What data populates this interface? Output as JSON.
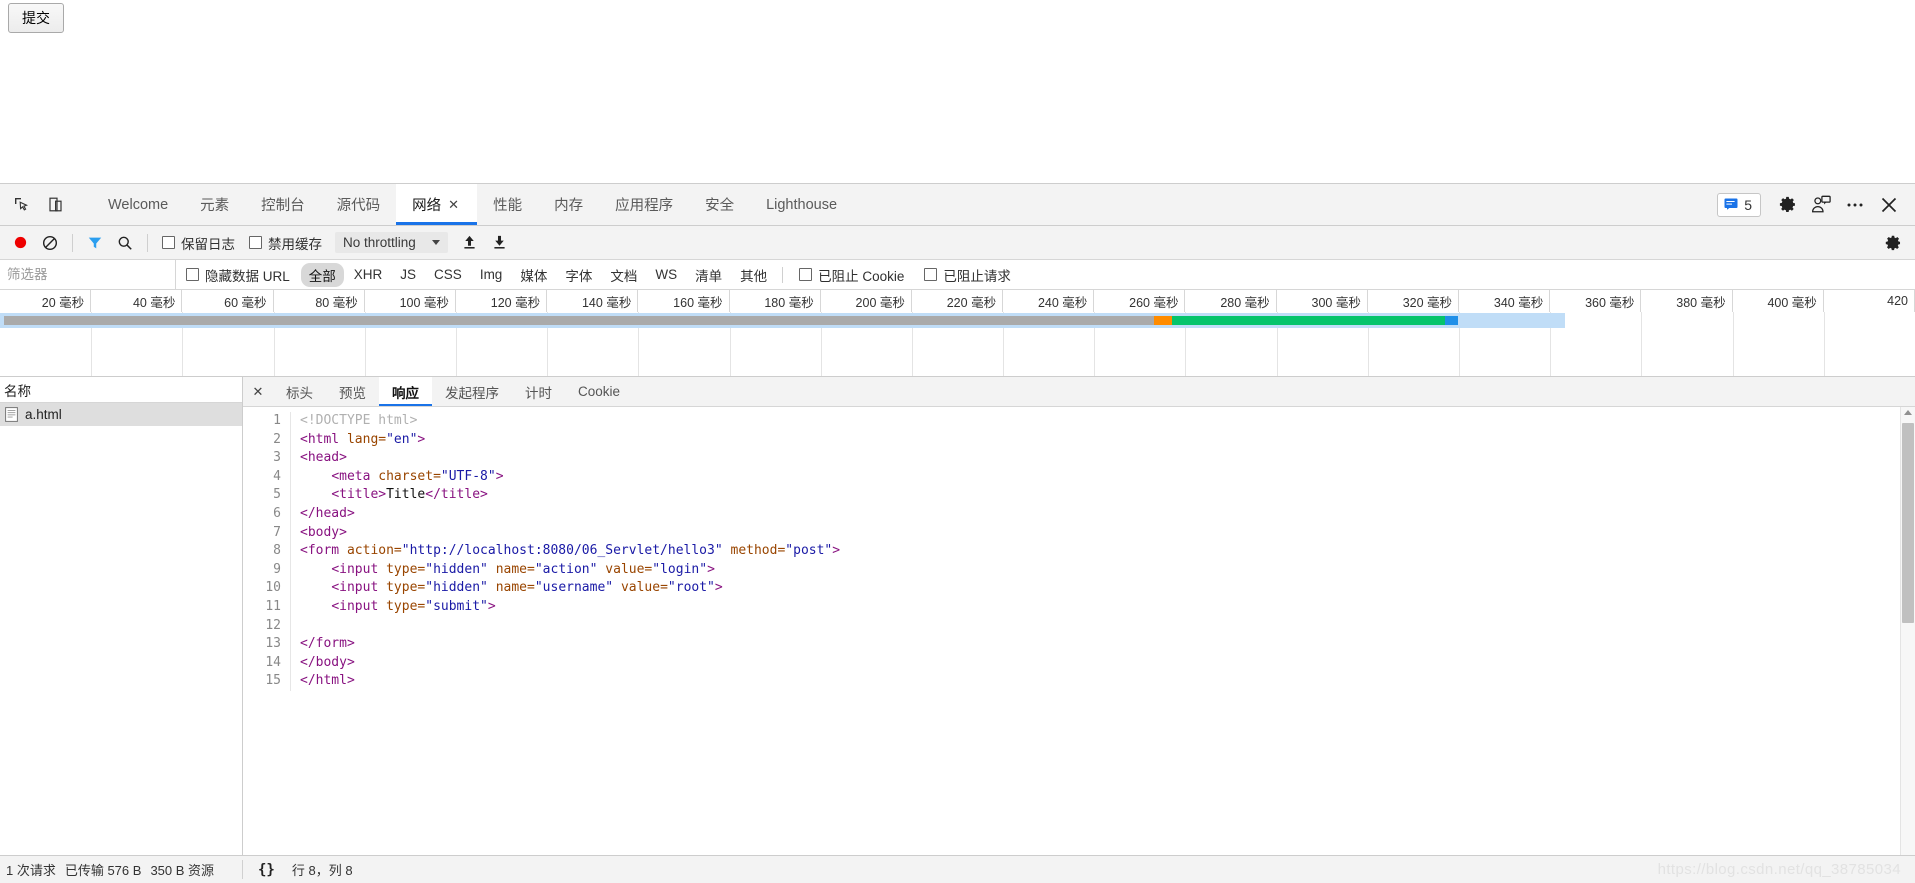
{
  "page": {
    "submit_button_label": "提交"
  },
  "tabbar": {
    "icons": [
      {
        "name": "inspect-element-icon"
      },
      {
        "name": "device-toolbar-icon"
      }
    ],
    "tabs": [
      {
        "label": "Welcome",
        "active": false
      },
      {
        "label": "元素",
        "active": false
      },
      {
        "label": "控制台",
        "active": false
      },
      {
        "label": "源代码",
        "active": false
      },
      {
        "label": "网络",
        "active": true,
        "close": "✕"
      },
      {
        "label": "性能",
        "active": false
      },
      {
        "label": "内存",
        "active": false
      },
      {
        "label": "应用程序",
        "active": false
      },
      {
        "label": "安全",
        "active": false
      },
      {
        "label": "Lighthouse",
        "active": false
      }
    ],
    "message_count": "5",
    "right_icons": [
      {
        "name": "settings-gear-icon"
      },
      {
        "name": "feedback-icon"
      },
      {
        "name": "more-options-icon"
      },
      {
        "name": "close-devtools-icon"
      }
    ]
  },
  "network_toolbar": {
    "record_title": "record-button",
    "clear_title": "clear-button",
    "filter_title": "filter-toggle",
    "search_title": "search-button",
    "preserve_log_label": "保留日志",
    "disable_cache_label": "禁用缓存",
    "throttling_value": "No throttling",
    "import_title": "import-har",
    "export_title": "export-har",
    "settings_title": "network-settings"
  },
  "filter_bar": {
    "filter_placeholder": "筛选器",
    "filter_value": "",
    "hide_data_urls_label": "隐藏数据 URL",
    "types": [
      {
        "label": "全部",
        "selected": true
      },
      {
        "label": "XHR",
        "selected": false
      },
      {
        "label": "JS",
        "selected": false
      },
      {
        "label": "CSS",
        "selected": false
      },
      {
        "label": "Img",
        "selected": false
      },
      {
        "label": "媒体",
        "selected": false
      },
      {
        "label": "字体",
        "selected": false
      },
      {
        "label": "文档",
        "selected": false
      },
      {
        "label": "WS",
        "selected": false
      },
      {
        "label": "清单",
        "selected": false
      },
      {
        "label": "其他",
        "selected": false
      }
    ],
    "blocked_cookies_label": "已阻止 Cookie",
    "blocked_requests_label": "已阻止请求"
  },
  "overview": {
    "ticks": [
      "20 毫秒",
      "40 毫秒",
      "60 毫秒",
      "80 毫秒",
      "100 毫秒",
      "120 毫秒",
      "140 毫秒",
      "160 毫秒",
      "180 毫秒",
      "200 毫秒",
      "220 毫秒",
      "240 毫秒",
      "260 毫秒",
      "280 毫秒",
      "300 毫秒",
      "320 毫秒",
      "340 毫秒",
      "360 毫秒",
      "380 毫秒",
      "400 毫秒",
      "420"
    ],
    "waterfall_colors": {
      "queueing": "#aaaaaa",
      "stalled": "#ff8c00",
      "waiting": "#05c46b",
      "download": "#1f8fe8",
      "band": "#c0ddf7"
    }
  },
  "request_list": {
    "column_header": "名称",
    "rows": [
      {
        "name": "a.html",
        "selected": true
      }
    ]
  },
  "detail_panel": {
    "close_label": "✕",
    "tabs": [
      {
        "label": "标头",
        "active": false
      },
      {
        "label": "预览",
        "active": false
      },
      {
        "label": "响应",
        "active": true
      },
      {
        "label": "发起程序",
        "active": false
      },
      {
        "label": "计时",
        "active": false
      },
      {
        "label": "Cookie",
        "active": false
      }
    ],
    "code_lines": [
      {
        "n": "1",
        "tokens": [
          {
            "t": "doc",
            "v": "<!DOCTYPE html>"
          }
        ]
      },
      {
        "n": "2",
        "tokens": [
          {
            "t": "tag",
            "v": "<html "
          },
          {
            "t": "attr",
            "v": "lang="
          },
          {
            "t": "val",
            "v": "\"en\""
          },
          {
            "t": "tag",
            "v": ">"
          }
        ]
      },
      {
        "n": "3",
        "tokens": [
          {
            "t": "tag",
            "v": "<head>"
          }
        ]
      },
      {
        "n": "4",
        "tokens": [
          {
            "t": "txt",
            "v": "    "
          },
          {
            "t": "tag",
            "v": "<meta "
          },
          {
            "t": "attr",
            "v": "charset="
          },
          {
            "t": "val",
            "v": "\"UTF-8\""
          },
          {
            "t": "tag",
            "v": ">"
          }
        ]
      },
      {
        "n": "5",
        "tokens": [
          {
            "t": "txt",
            "v": "    "
          },
          {
            "t": "tag",
            "v": "<title>"
          },
          {
            "t": "txt",
            "v": "Title"
          },
          {
            "t": "tag",
            "v": "</title>"
          }
        ]
      },
      {
        "n": "6",
        "tokens": [
          {
            "t": "tag",
            "v": "</head>"
          }
        ]
      },
      {
        "n": "7",
        "tokens": [
          {
            "t": "tag",
            "v": "<body>"
          }
        ]
      },
      {
        "n": "8",
        "tokens": [
          {
            "t": "tag",
            "v": "<form "
          },
          {
            "t": "attr",
            "v": "action="
          },
          {
            "t": "val",
            "v": "\"http://localhost:8080/06_Servlet/hello3\""
          },
          {
            "t": "attr",
            "v": " method="
          },
          {
            "t": "val",
            "v": "\"post\""
          },
          {
            "t": "tag",
            "v": ">"
          }
        ]
      },
      {
        "n": "9",
        "tokens": [
          {
            "t": "txt",
            "v": "    "
          },
          {
            "t": "tag",
            "v": "<input "
          },
          {
            "t": "attr",
            "v": "type="
          },
          {
            "t": "val",
            "v": "\"hidden\""
          },
          {
            "t": "attr",
            "v": " name="
          },
          {
            "t": "val",
            "v": "\"action\""
          },
          {
            "t": "attr",
            "v": " value="
          },
          {
            "t": "val",
            "v": "\"login\""
          },
          {
            "t": "tag",
            "v": ">"
          }
        ]
      },
      {
        "n": "10",
        "tokens": [
          {
            "t": "txt",
            "v": "    "
          },
          {
            "t": "tag",
            "v": "<input "
          },
          {
            "t": "attr",
            "v": "type="
          },
          {
            "t": "val",
            "v": "\"hidden\""
          },
          {
            "t": "attr",
            "v": " name="
          },
          {
            "t": "val",
            "v": "\"username\""
          },
          {
            "t": "attr",
            "v": " value="
          },
          {
            "t": "val",
            "v": "\"root\""
          },
          {
            "t": "tag",
            "v": ">"
          }
        ]
      },
      {
        "n": "11",
        "tokens": [
          {
            "t": "txt",
            "v": "    "
          },
          {
            "t": "tag",
            "v": "<input "
          },
          {
            "t": "attr",
            "v": "type="
          },
          {
            "t": "val",
            "v": "\"submit\""
          },
          {
            "t": "tag",
            "v": ">"
          }
        ]
      },
      {
        "n": "12",
        "tokens": [
          {
            "t": "txt",
            "v": ""
          }
        ]
      },
      {
        "n": "13",
        "tokens": [
          {
            "t": "tag",
            "v": "</form>"
          }
        ]
      },
      {
        "n": "14",
        "tokens": [
          {
            "t": "tag",
            "v": "</body>"
          }
        ]
      },
      {
        "n": "15",
        "tokens": [
          {
            "t": "tag",
            "v": "</html>"
          }
        ]
      }
    ]
  },
  "status_bar": {
    "requests": "1 次请求",
    "transferred": "已传输 576 B",
    "resources": "350 B 资源",
    "format_button": "{}",
    "cursor_position": "行 8，列 8",
    "watermark": "https://blog.csdn.net/qq_38785034"
  }
}
